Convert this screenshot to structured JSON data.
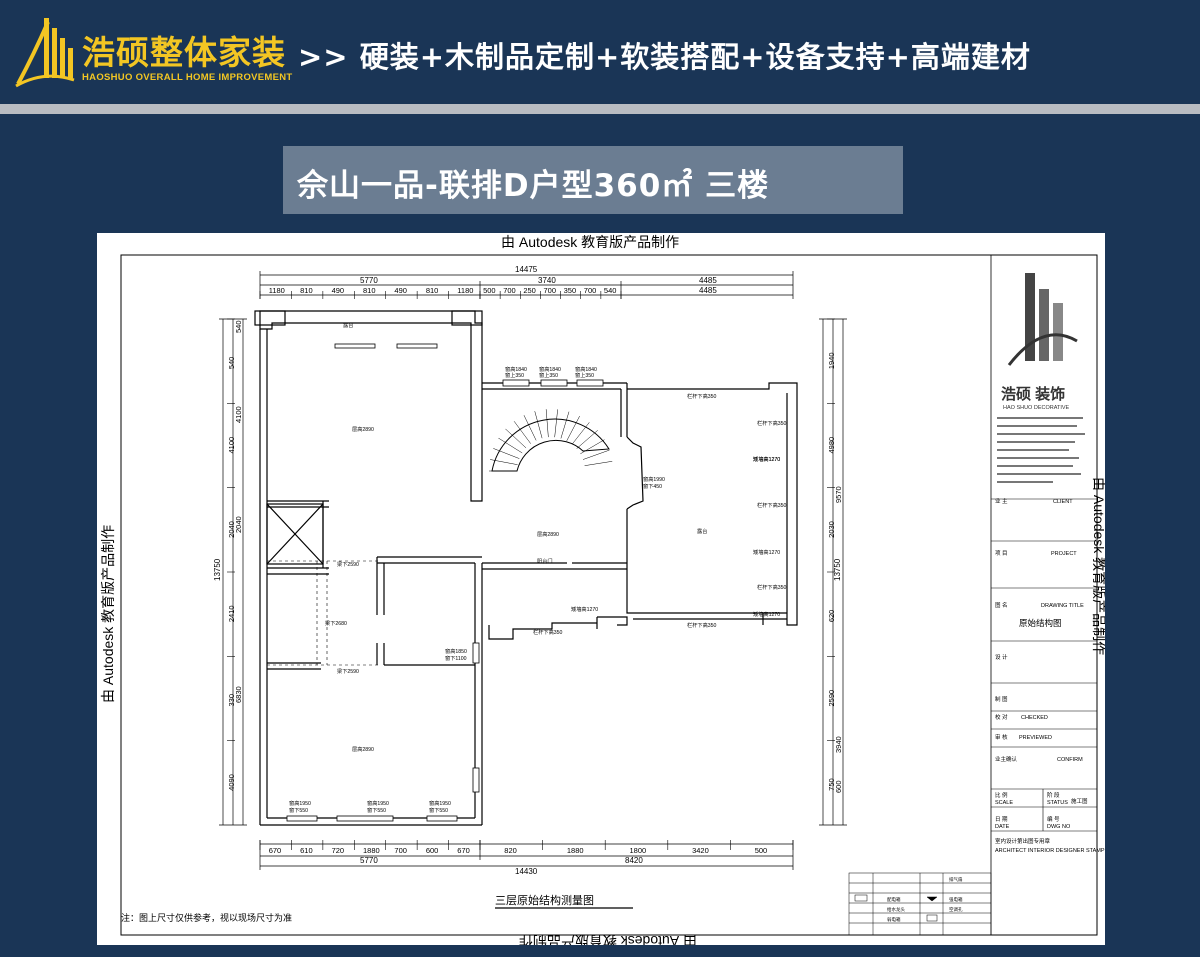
{
  "header": {
    "brand_name": "浩硕整体家装",
    "brand_name_en": "HAOSHUO OVERALL HOME IMPROVEMENT",
    "slogan": ">> 硬装+木制品定制+软装搭配+设备支持+高端建材",
    "logo_icon": "building-skyline-logo",
    "colors": {
      "background": "#1a3556",
      "accent": "#f3c623",
      "rule": "#b9bcc2"
    }
  },
  "title": {
    "text": "佘山一品-联排D户型360㎡ 三楼"
  },
  "drawing": {
    "watermark_top": "由 Autodesk 教育版产品制作",
    "watermark_bottom": "由 Autodesk 教育版产品制作",
    "watermark_left": "由 Autodesk 教育版产品制作",
    "watermark_right": "由 Autodesk 教育版产品制作",
    "caption": "三层原始结构测量图",
    "note": "注：图上尺寸仅供参考，视以现场尺寸为准",
    "top_dims": {
      "overall": "14475",
      "left_total": "5770",
      "mid_total": "3740",
      "right_total": "4485",
      "right_sub": "4485",
      "left_segments": [
        "1180",
        "810",
        "490",
        "810",
        "490",
        "810",
        "1180"
      ],
      "mid_segments": [
        "500",
        "700",
        "250",
        "700",
        "350",
        "700",
        "540"
      ]
    },
    "bottom_dims": {
      "left_segments": [
        "670",
        "610",
        "720",
        "1880",
        "700",
        "600",
        "670"
      ],
      "right_segments": [
        "820",
        "1880",
        "1800",
        "3420",
        "500"
      ],
      "left_total": "5770",
      "right_total": "8420",
      "overall": "14430"
    },
    "left_dims": {
      "overall": "13750",
      "segments": [
        "540",
        "4100",
        "2040",
        "2410",
        "330",
        "4090"
      ],
      "inner": [
        "540",
        "4100",
        "2040",
        "6830"
      ]
    },
    "right_dims": {
      "overall": "13750",
      "segments": [
        "1940",
        "4980",
        "2030",
        "620",
        "2590",
        "750"
      ],
      "inner": [
        "9570",
        "3940",
        "600"
      ]
    },
    "plan_labels": [
      "露台",
      "层高2890",
      "层高2890",
      "阳台门",
      "层高2890",
      "露台",
      "梁下2590",
      "梁下2680",
      "梁下2590",
      "窗高1850",
      "窗下1100",
      "窗高1840",
      "窗上350",
      "窗高1840",
      "窗上350",
      "窗高1840",
      "窗上350",
      "窗高1990",
      "窗下450",
      "栏杆下高350",
      "栏杆下高350",
      "栏杆下高350",
      "栏杆下高350",
      "栏杆下高350",
      "栏杆下高350",
      "矮墙高1270",
      "矮墙高1270",
      "矮墙高1270",
      "矮墙高1270",
      "矮墙高1270",
      "窗高1950",
      "窗下550",
      "窗高1950",
      "窗下550",
      "窗高1950",
      "窗下550"
    ],
    "title_block": {
      "company": "浩硕 装饰",
      "company_en": "HAO SHUO DECORATIVE",
      "client_label": "业 主",
      "client_en": "CLIENT",
      "project_label": "项 目",
      "project_en": "PROJECT",
      "drawing_label": "图 名",
      "drawing_en": "DRAWING TITLE",
      "drawing_title": "原始结构图",
      "design_label": "设 计",
      "drawn_label": "制 图",
      "checked_label": "校 对",
      "checked_en": "CHECKED",
      "reviewed_label": "审 核",
      "reviewed_en": "PREVIEWED",
      "confirm_label": "业主确认",
      "confirm_en": "CONFIRM",
      "scale_label": "比 例",
      "scale_en": "SCALE",
      "status_label": "阶 段",
      "status_en": "STATUS",
      "status_value": "施工图",
      "date_label": "日 期",
      "date_en": "DATE",
      "dwg_label": "编 号",
      "dwg_en": "DWG NO",
      "stamp_label": "室内设计第出图专用章",
      "stamp_en": "ARCHITECT INTERIOR DESIGNER STAMP"
    },
    "legend_rows": [
      "排气扇",
      "配电箱",
      "强电箱",
      "给水龙头",
      "空调孔",
      "弱电箱"
    ]
  }
}
